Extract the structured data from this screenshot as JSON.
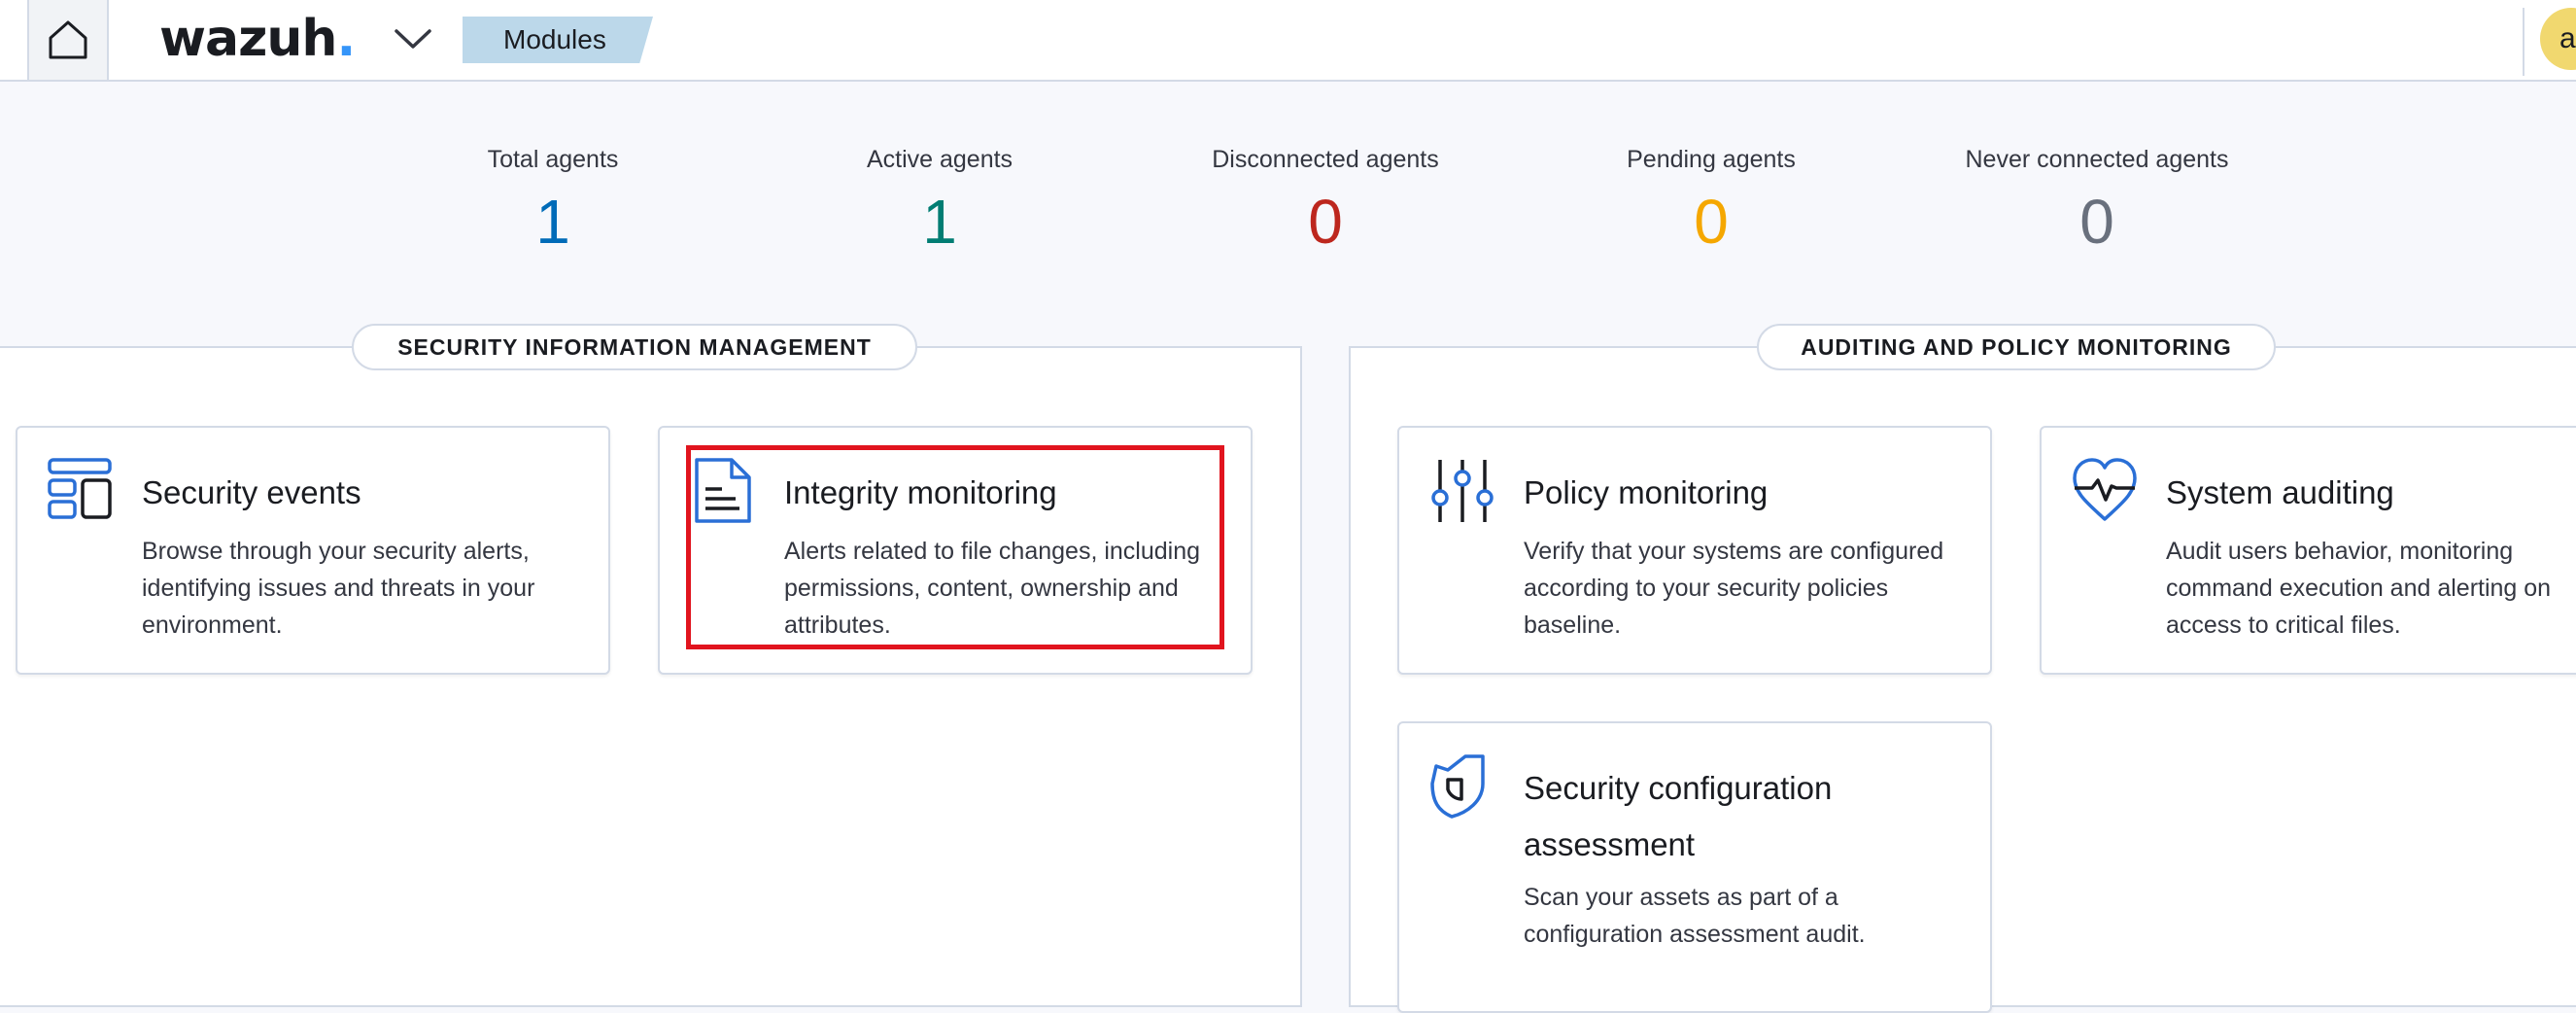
{
  "header": {
    "logo_text": "wazuh",
    "logo_dot": ".",
    "breadcrumb": "Modules",
    "avatar_initial": "a",
    "icons": [
      "home-icon",
      "chevron-down-icon"
    ]
  },
  "stats": [
    {
      "label": "Total agents",
      "value": "1",
      "color": "#006bb8"
    },
    {
      "label": "Active agents",
      "value": "1",
      "color": "#017d73"
    },
    {
      "label": "Disconnected agents",
      "value": "0",
      "color": "#bd271e"
    },
    {
      "label": "Pending agents",
      "value": "0",
      "color": "#f5a700"
    },
    {
      "label": "Never connected agents",
      "value": "0",
      "color": "#69707d"
    }
  ],
  "sections": {
    "sim": {
      "title": "SECURITY INFORMATION MANAGEMENT",
      "cards": [
        {
          "title": "Security events",
          "description": "Browse through your security alerts, identifying issues and threats in your environment.",
          "icon": "dashboard-layout-icon"
        },
        {
          "title": "Integrity monitoring",
          "description": "Alerts related to file changes, including permissions, content, ownership and attributes.",
          "icon": "document-icon"
        }
      ]
    },
    "apm": {
      "title": "AUDITING AND POLICY MONITORING",
      "cards": [
        {
          "title": "Policy monitoring",
          "description": "Verify that your systems are configured according to your security policies baseline.",
          "icon": "sliders-icon"
        },
        {
          "title": "System auditing",
          "description": "Audit users behavior, monitoring command execution and alerting on access to critical files.",
          "icon": "heart-pulse-icon"
        },
        {
          "title": "Security configuration assessment",
          "description": "Scan your assets as part of a configuration assessment audit.",
          "icon": "shield-icon"
        }
      ]
    }
  },
  "colors": {
    "accent": "#006bb8",
    "icon_blue": "#2a6fd6",
    "highlight": "#e1141e",
    "breadcrumb_bg": "#bcd8ea"
  }
}
